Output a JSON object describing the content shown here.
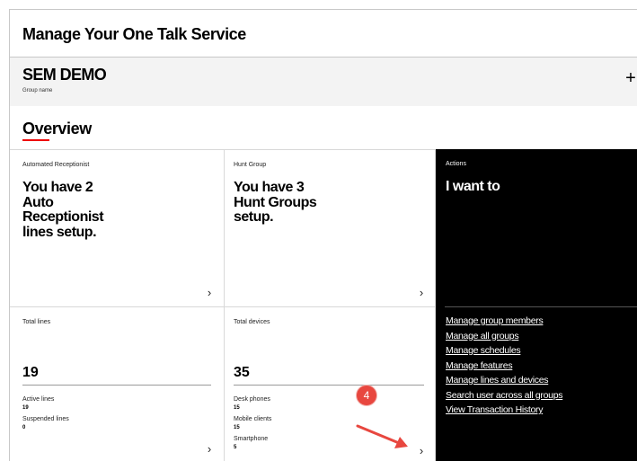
{
  "page": {
    "title": "Manage Your One Talk Service"
  },
  "group": {
    "name": "SEM DEMO",
    "caption": "Group name",
    "expand_icon": "plus-icon"
  },
  "overview": {
    "heading": "Overview",
    "accent": "#ee0000"
  },
  "cards": {
    "auto_receptionist": {
      "eyebrow": "Automated Receptionist",
      "line1": "You have 2",
      "line2": "Auto",
      "line3": "Receptionist",
      "line4": "lines setup."
    },
    "hunt_group": {
      "eyebrow": "Hunt Group",
      "line1": "You have 3",
      "line2": "Hunt Groups",
      "line3": "setup."
    },
    "total_lines": {
      "eyebrow": "Total lines",
      "value": "19",
      "active_label": "Active lines",
      "active_value": "19",
      "suspended_label": "Suspended lines",
      "suspended_value": "0"
    },
    "total_devices": {
      "eyebrow": "Total devices",
      "value": "35",
      "desk_label": "Desk phones",
      "desk_value": "15",
      "mobile_label": "Mobile clients",
      "mobile_value": "15",
      "smart_label": "Smartphone",
      "smart_value": "5"
    }
  },
  "actions": {
    "eyebrow": "Actions",
    "headline": "I want to",
    "links": [
      "Manage group members",
      "Manage all groups",
      "Manage schedules",
      "Manage features",
      "Manage lines and devices",
      "Search user across all groups",
      "View Transaction History"
    ]
  },
  "annotation": {
    "step": "4",
    "color": "#e8473f"
  }
}
